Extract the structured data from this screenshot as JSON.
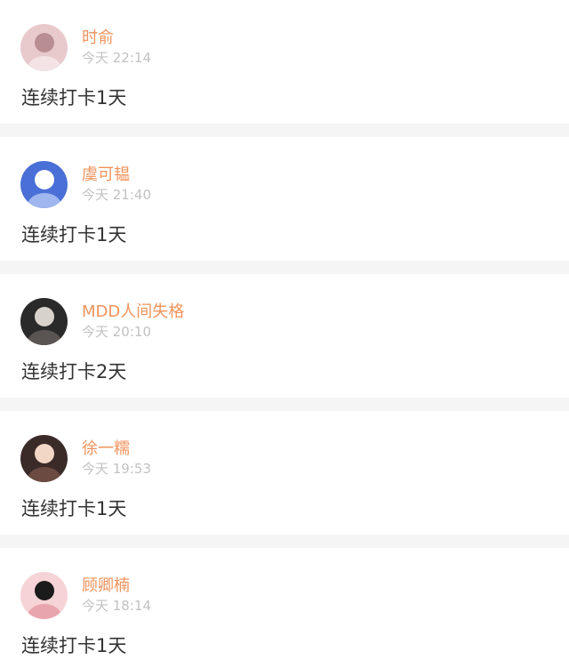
{
  "colors": {
    "username": "#f0935c",
    "timestamp": "#c2c2c2",
    "body_text": "#333333",
    "separator": "#f5f5f5"
  },
  "posts": [
    {
      "username": "时俞",
      "timestamp": "今天 22:14",
      "checkin_text": "连续打卡1天",
      "avatar": "avatar-pink-clothing-icon",
      "avatar_colors": [
        "#e8c9cc",
        "#b98e93",
        "#f3e3e4"
      ]
    },
    {
      "username": "虞可韫",
      "timestamp": "今天 21:40",
      "checkin_text": "连续打卡1天",
      "avatar": "avatar-blue-stage-icon",
      "avatar_colors": [
        "#4a6fd6",
        "#ffffff",
        "#9fb6ee"
      ]
    },
    {
      "username": "MDD人间失格",
      "timestamp": "今天 20:10",
      "checkin_text": "连续打卡2天",
      "avatar": "avatar-dark-portrait-icon",
      "avatar_colors": [
        "#2a2a2a",
        "#d8d2cd",
        "#5a5552"
      ]
    },
    {
      "username": "徐一糯",
      "timestamp": "今天 19:53",
      "checkin_text": "连续打卡1天",
      "avatar": "avatar-girl-smiling-icon",
      "avatar_colors": [
        "#3b2b28",
        "#f2d6c6",
        "#6b4a42"
      ]
    },
    {
      "username": "顾卿楠",
      "timestamp": "今天 18:14",
      "checkin_text": "连续打卡1天",
      "avatar": "avatar-pink-dark-icon",
      "avatar_colors": [
        "#f6d3d6",
        "#1b1b1b",
        "#e8a5ad"
      ]
    }
  ]
}
